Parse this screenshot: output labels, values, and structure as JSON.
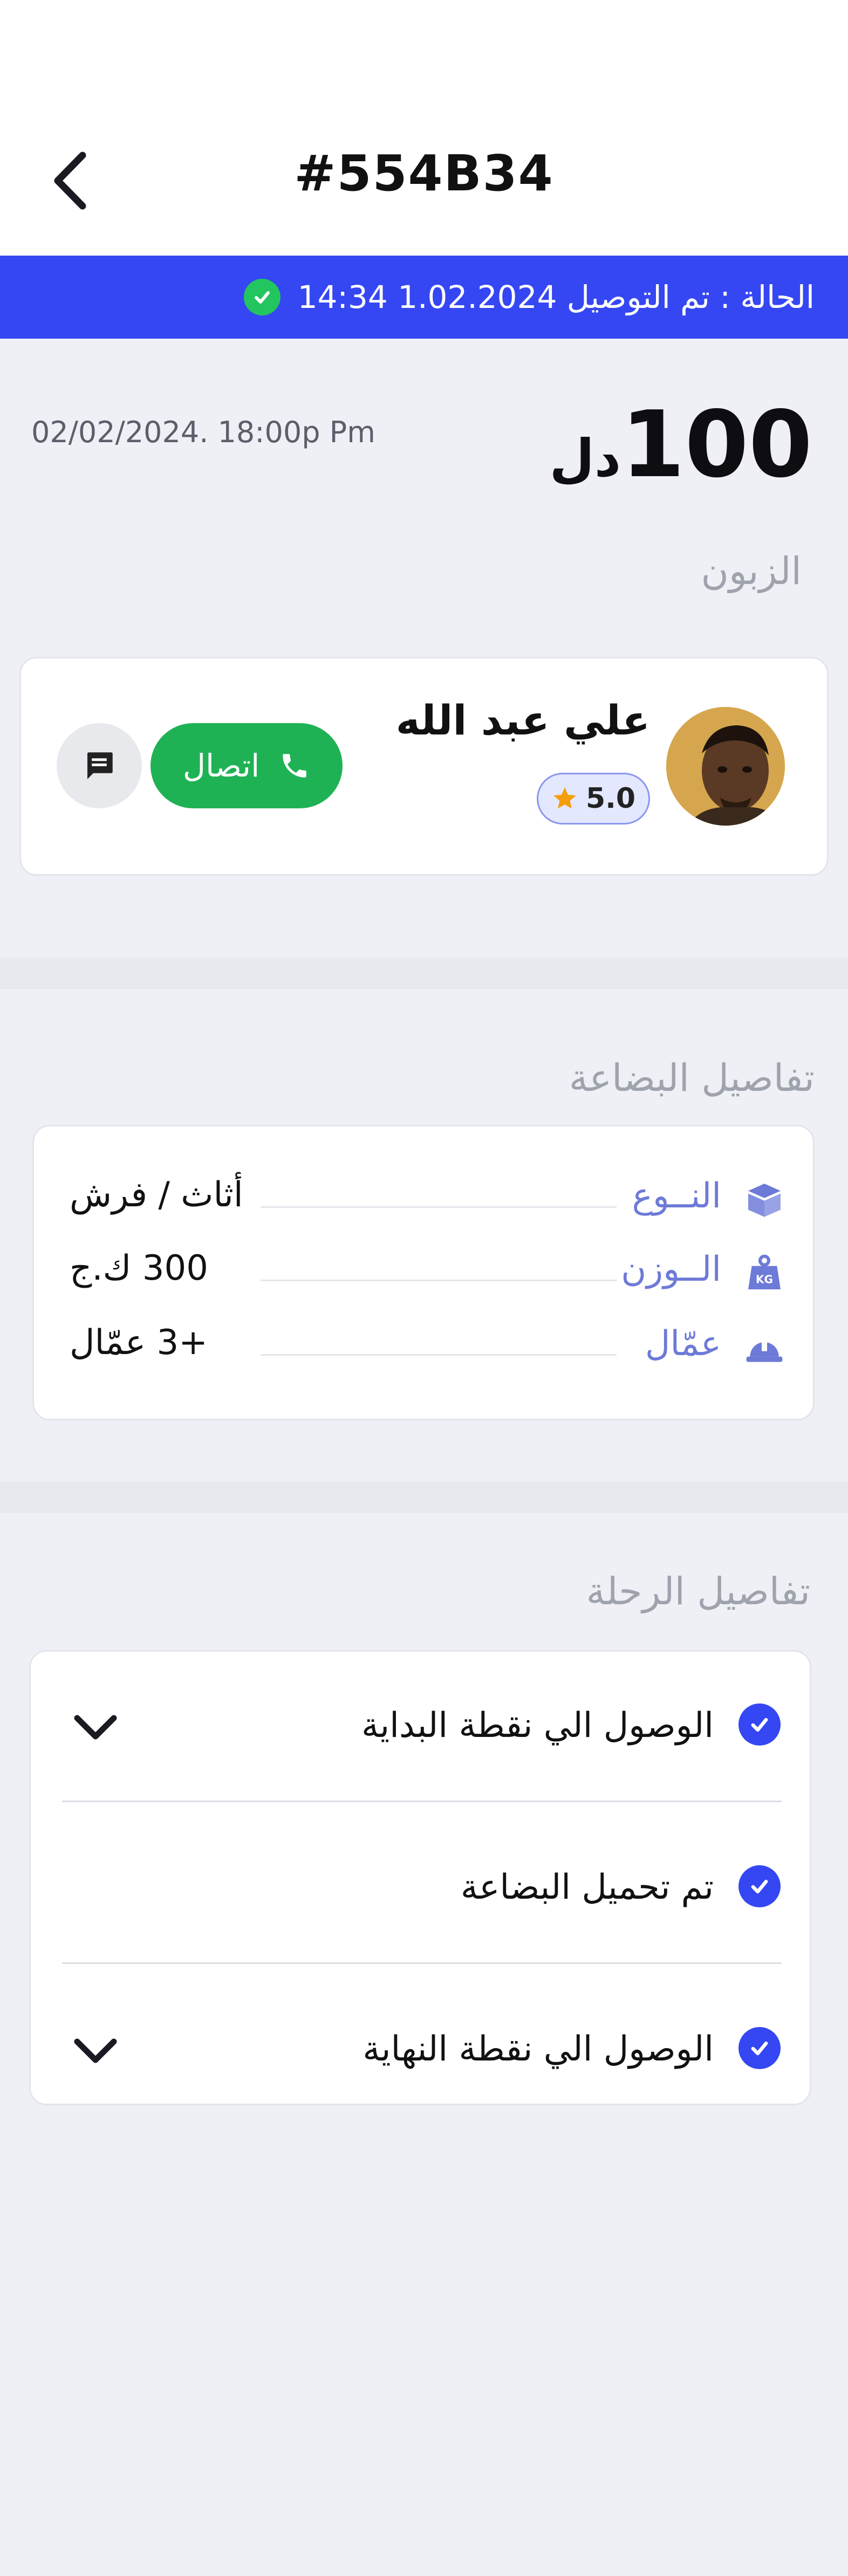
{
  "header": {
    "order_id": "#554B34",
    "back_icon": "chevron-left-icon"
  },
  "status": {
    "text": "الحالة : تم التوصيل 1.02.2024 14:34",
    "color": "#3547f2",
    "check_color": "#22c55e"
  },
  "order": {
    "price": "100",
    "currency": "دل",
    "date": "02/02/2024. 18:00p Pm"
  },
  "customer": {
    "section_title": "الزبون",
    "name": "علي عبد الله",
    "rating": "5.0",
    "call_label": "اتصال",
    "call_color": "#1fb254",
    "chat_icon": "chat-icon",
    "phone_icon": "phone-icon",
    "star_icon": "star-icon"
  },
  "goods": {
    "section_title": "تفاصيل البضاعة",
    "rows": [
      {
        "label": "النــوع",
        "value": "أثاث / فرش",
        "icon": "box-icon"
      },
      {
        "label": "الــوزن",
        "value": "300 ك.ج",
        "icon": "weight-icon"
      },
      {
        "label": "عمّال",
        "value": "+3 عمّال",
        "icon": "helmet-icon"
      }
    ],
    "label_color": "#6d7ad8"
  },
  "trip": {
    "section_title": "تفاصيل الرحلة",
    "steps": [
      {
        "label": "الوصول الي نقطة البداية",
        "expandable": true
      },
      {
        "label": "تم تحميل البضاعة",
        "expandable": false
      },
      {
        "label": "الوصول الي نقطة النهاية",
        "expandable": true
      }
    ]
  }
}
